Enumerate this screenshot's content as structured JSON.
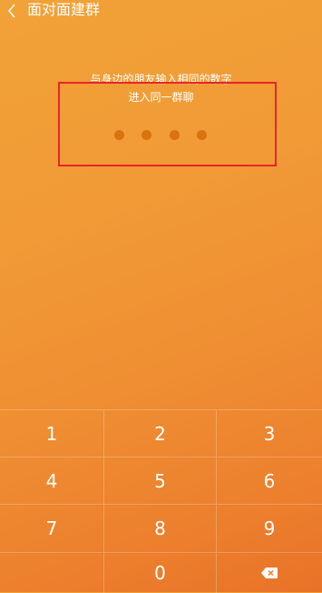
{
  "header": {
    "title": "面对面建群",
    "back_icon": "chevron-left-icon"
  },
  "prompt": {
    "line1": "与身边的朋友输入相同的数字",
    "line2": "进入同一群聊"
  },
  "pin": {
    "length": 4,
    "entered": 0
  },
  "keypad": {
    "keys": [
      "1",
      "2",
      "3",
      "4",
      "5",
      "6",
      "7",
      "8",
      "9",
      "",
      "0"
    ],
    "delete_icon": "backspace-icon"
  },
  "colors": {
    "background_top": "#f1a238",
    "background_bottom": "#e97228",
    "dot": "#d8730f",
    "highlight_border": "#e8252a"
  }
}
